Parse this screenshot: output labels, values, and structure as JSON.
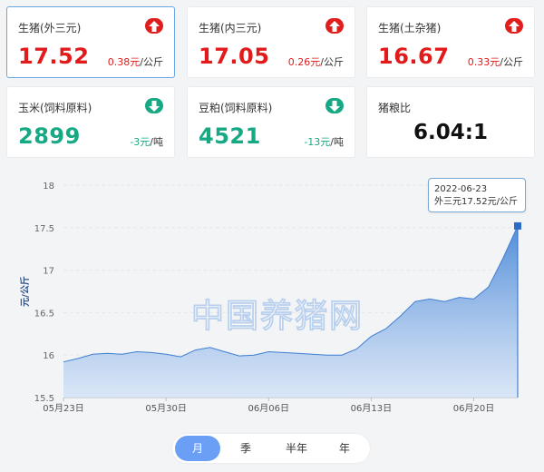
{
  "cards": [
    {
      "name": "生猪(外三元)",
      "price": "17.52",
      "change": "0.38元",
      "unit": "/公斤",
      "trend": "up"
    },
    {
      "name": "生猪(内三元)",
      "price": "17.05",
      "change": "0.26元",
      "unit": "/公斤",
      "trend": "up"
    },
    {
      "name": "生猪(土杂猪)",
      "price": "16.67",
      "change": "0.33元",
      "unit": "/公斤",
      "trend": "up"
    },
    {
      "name": "玉米(饲料原料)",
      "price": "2899",
      "change": "-3元",
      "unit": "/吨",
      "trend": "down"
    },
    {
      "name": "豆粕(饲料原料)",
      "price": "4521",
      "change": "-13元",
      "unit": "/吨",
      "trend": "down"
    }
  ],
  "ratio_card": {
    "name": "猪粮比",
    "value": "6.04:1"
  },
  "tooltip": {
    "date": "2022-06-23",
    "text": "外三元17.52元/公斤"
  },
  "watermark": "中国养猪网",
  "periods": [
    "月",
    "季",
    "半年",
    "年"
  ],
  "active_period": "月",
  "colors": {
    "up": "#e11b1b",
    "down": "#17a884",
    "accent": "#6b9ff5",
    "area": "#4f8fdc"
  },
  "chart_data": {
    "type": "area",
    "ylabel": "元/公斤",
    "ylim": [
      15.5,
      18
    ],
    "yticks": [
      "18",
      "17.5",
      "17",
      "16.5",
      "16",
      "15.5"
    ],
    "xticks": [
      "05月23日",
      "05月30日",
      "06月06日",
      "06月13日",
      "06月20日"
    ],
    "x": [
      "05-23",
      "05-24",
      "05-25",
      "05-26",
      "05-27",
      "05-28",
      "05-29",
      "05-30",
      "05-31",
      "06-01",
      "06-02",
      "06-03",
      "06-04",
      "06-05",
      "06-06",
      "06-07",
      "06-08",
      "06-09",
      "06-10",
      "06-11",
      "06-12",
      "06-13",
      "06-14",
      "06-15",
      "06-16",
      "06-17",
      "06-18",
      "06-19",
      "06-20",
      "06-21",
      "06-22",
      "06-23"
    ],
    "values": [
      15.92,
      15.96,
      16.01,
      16.02,
      16.01,
      16.04,
      16.03,
      16.01,
      15.98,
      16.06,
      16.09,
      16.04,
      15.99,
      16.0,
      16.04,
      16.03,
      16.02,
      16.01,
      16.0,
      16.0,
      16.07,
      16.22,
      16.31,
      16.46,
      16.63,
      16.66,
      16.63,
      16.68,
      16.66,
      16.8,
      17.14,
      17.52
    ],
    "grid": true
  }
}
